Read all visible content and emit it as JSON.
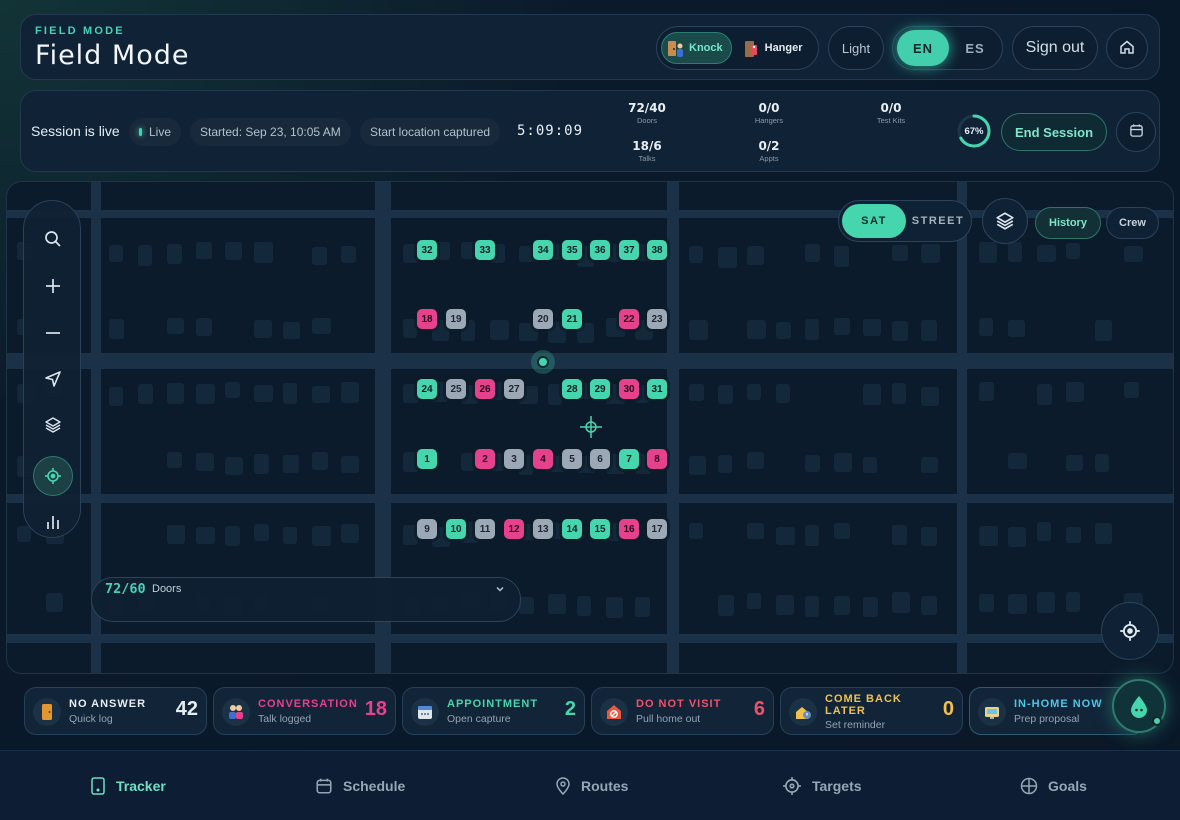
{
  "header": {
    "eyebrow": "FIELD MODE",
    "title": "Field Mode",
    "knock_label": "Knock",
    "hanger_label": "Hanger",
    "light_label": "Light",
    "lang_en": "EN",
    "lang_es": "ES",
    "signout_label": "Sign out"
  },
  "session": {
    "title": "Session is live",
    "live_label": "Live",
    "started": "Started: Sep 23, 10:05 AM",
    "location": "Start location captured",
    "timer": "5:09:09",
    "stats": [
      {
        "value": "72/40",
        "label": "Doors"
      },
      {
        "value": "0/0",
        "label": "Hangers"
      },
      {
        "value": "0/0",
        "label": "Test Kits"
      },
      {
        "value": "18/6",
        "label": "Talks"
      },
      {
        "value": "0/2",
        "label": "Appts"
      }
    ],
    "progress_label": "67%",
    "progress": 0.67,
    "end_label": "End Session"
  },
  "map": {
    "sat_label": "SAT",
    "street_label": "STREET",
    "history_label": "History",
    "crew_label": "Crew",
    "doors_count": "72/60",
    "doors_label": "Doors",
    "markers": [
      {
        "n": "32",
        "status": "green"
      },
      {
        "n": "33",
        "status": "green"
      },
      {
        "n": "34",
        "status": "green"
      },
      {
        "n": "35",
        "status": "green"
      },
      {
        "n": "36",
        "status": "green"
      },
      {
        "n": "37",
        "status": "green"
      },
      {
        "n": "38",
        "status": "green"
      },
      {
        "n": "18",
        "status": "pink"
      },
      {
        "n": "19",
        "status": "gray"
      },
      {
        "n": "20",
        "status": "gray"
      },
      {
        "n": "21",
        "status": "green"
      },
      {
        "n": "22",
        "status": "pink"
      },
      {
        "n": "23",
        "status": "gray"
      },
      {
        "n": "24",
        "status": "green"
      },
      {
        "n": "25",
        "status": "gray"
      },
      {
        "n": "26",
        "status": "pink"
      },
      {
        "n": "27",
        "status": "gray"
      },
      {
        "n": "28",
        "status": "green"
      },
      {
        "n": "29",
        "status": "green"
      },
      {
        "n": "30",
        "status": "pink"
      },
      {
        "n": "31",
        "status": "green"
      },
      {
        "n": "1",
        "status": "green"
      },
      {
        "n": "2",
        "status": "pink"
      },
      {
        "n": "3",
        "status": "gray"
      },
      {
        "n": "4",
        "status": "pink"
      },
      {
        "n": "5",
        "status": "gray"
      },
      {
        "n": "6",
        "status": "gray"
      },
      {
        "n": "7",
        "status": "green"
      },
      {
        "n": "8",
        "status": "pink"
      },
      {
        "n": "9",
        "status": "gray"
      },
      {
        "n": "10",
        "status": "green"
      },
      {
        "n": "11",
        "status": "gray"
      },
      {
        "n": "12",
        "status": "pink"
      },
      {
        "n": "13",
        "status": "gray"
      },
      {
        "n": "14",
        "status": "green"
      },
      {
        "n": "15",
        "status": "green"
      },
      {
        "n": "16",
        "status": "pink"
      },
      {
        "n": "17",
        "status": "gray"
      }
    ]
  },
  "outcomes": [
    {
      "title": "NO ANSWER",
      "sub": "Quick log",
      "count": "42",
      "color": "#e6edf3"
    },
    {
      "title": "CONVERSATION",
      "sub": "Talk logged",
      "count": "18",
      "color": "#e5418d"
    },
    {
      "title": "APPOINTMENT",
      "sub": "Open capture",
      "count": "2",
      "color": "#46d6ad"
    },
    {
      "title": "DO NOT VISIT",
      "sub": "Pull home out",
      "count": "6",
      "color": "#f0516a"
    },
    {
      "title": "COME BACK LATER",
      "sub": "Set reminder",
      "count": "0",
      "color": "#f2c14b"
    },
    {
      "title": "IN-HOME NOW",
      "sub": "Prep proposal",
      "count": "",
      "color": "#4ec6e8"
    }
  ],
  "nav": [
    {
      "label": "Tracker",
      "icon": "phone-icon"
    },
    {
      "label": "Schedule",
      "icon": "calendar-icon"
    },
    {
      "label": "Routes",
      "icon": "pin-icon"
    },
    {
      "label": "Targets",
      "icon": "target-icon"
    },
    {
      "label": "Goals",
      "icon": "globe-icon"
    }
  ],
  "colors": {
    "accent": "#46d6ad",
    "pink": "#e5418d",
    "gray": "#9ca8b6",
    "background": "#0a1828"
  }
}
